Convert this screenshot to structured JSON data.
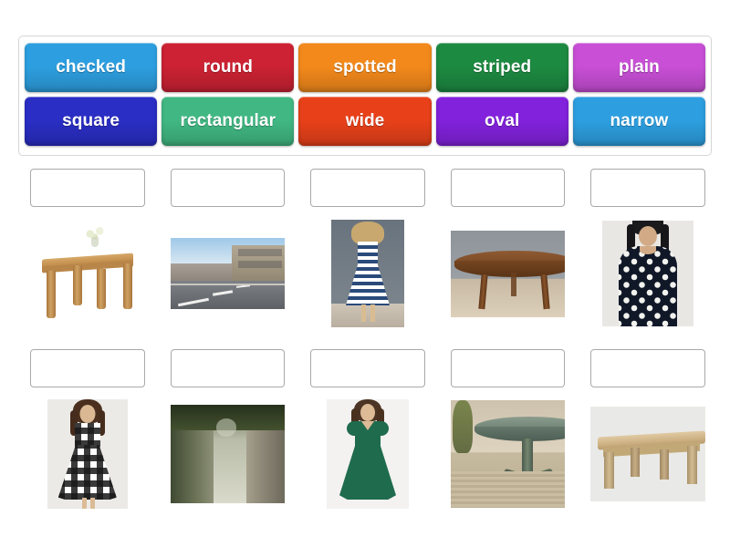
{
  "activity": {
    "type": "match-up-drag-and-drop",
    "title": "Match up"
  },
  "word_bank": {
    "rows": [
      [
        {
          "label": "checked",
          "color": "#2d9fe0"
        },
        {
          "label": "round",
          "color": "#cc2233"
        },
        {
          "label": "spotted",
          "color": "#f3891b"
        },
        {
          "label": "striped",
          "color": "#1d8a41"
        },
        {
          "label": "plain",
          "color": "#c84fd6"
        }
      ],
      [
        {
          "label": "square",
          "color": "#2a2ec4"
        },
        {
          "label": "rectangular",
          "color": "#41b883"
        },
        {
          "label": "wide",
          "color": "#e8411a"
        },
        {
          "label": "oval",
          "color": "#8222dc"
        },
        {
          "label": "narrow",
          "color": "#2d9fe0"
        }
      ]
    ]
  },
  "drop_zones": {
    "row1": [
      {
        "index": 1,
        "value": "",
        "placeholder": ""
      },
      {
        "index": 2,
        "value": "",
        "placeholder": ""
      },
      {
        "index": 3,
        "value": "",
        "placeholder": ""
      },
      {
        "index": 4,
        "value": "",
        "placeholder": ""
      },
      {
        "index": 5,
        "value": "",
        "placeholder": ""
      }
    ],
    "row2": [
      {
        "index": 6,
        "value": "",
        "placeholder": ""
      },
      {
        "index": 7,
        "value": "",
        "placeholder": ""
      },
      {
        "index": 8,
        "value": "",
        "placeholder": ""
      },
      {
        "index": 9,
        "value": "",
        "placeholder": ""
      },
      {
        "index": 10,
        "value": "",
        "placeholder": ""
      }
    ]
  },
  "image_rows": {
    "row1": [
      {
        "index": 1,
        "name": "square-wooden-table-with-plant",
        "alt": "Square light oak dining table with a small vase of white flowers on top"
      },
      {
        "index": 2,
        "name": "wide-city-street",
        "alt": "Wide city street with lane markings and buildings on the right"
      },
      {
        "index": 3,
        "name": "striped-dress",
        "alt": "Woman wearing a blue and white horizontally striped dress"
      },
      {
        "index": 4,
        "name": "round-wooden-table",
        "alt": "Round dark wood antique table with turned legs"
      },
      {
        "index": 5,
        "name": "spotted-dress",
        "alt": "Woman wearing a navy dress with white polka dots"
      }
    ],
    "row2": [
      {
        "index": 6,
        "name": "checked-dress",
        "alt": "Woman wearing a black and white checked gingham dress"
      },
      {
        "index": 7,
        "name": "narrow-path",
        "alt": "Narrow stone walled footpath between hedges"
      },
      {
        "index": 8,
        "name": "plain-green-dress",
        "alt": "Woman wearing a plain dark green dress"
      },
      {
        "index": 9,
        "name": "oval-green-table",
        "alt": "Oval green painted pedestal table on a rug"
      },
      {
        "index": 10,
        "name": "rectangular-pine-table",
        "alt": "Rectangular pine dining table"
      }
    ]
  },
  "theme": {
    "page_background": "#ffffff",
    "bank_border": "#d6d6d6",
    "drop_border": "#a9a9a9",
    "tile_text": "#ffffff"
  }
}
